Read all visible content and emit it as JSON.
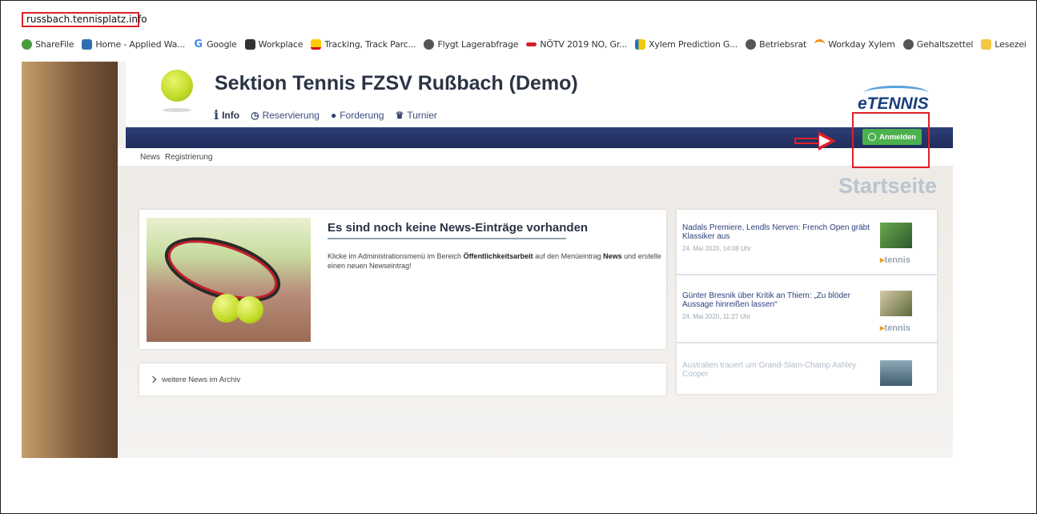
{
  "browser": {
    "url": "russbach.tennisplatz.info",
    "bookmarks": [
      {
        "label": "ShareFile",
        "icon": "sharefile-icon",
        "color": "#4a9d3c"
      },
      {
        "label": "Home - Applied Wa...",
        "icon": "home-icon",
        "color": "#2f6fb0"
      },
      {
        "label": "Google",
        "icon": "google-icon",
        "color": "#4285f4"
      },
      {
        "label": "Workplace",
        "icon": "workplace-icon",
        "color": "#333333"
      },
      {
        "label": "Tracking, Track Parc...",
        "icon": "dhl-icon",
        "color": "#ffcc00"
      },
      {
        "label": "Flygt Lagerabfrage",
        "icon": "globe-icon",
        "color": "#555555"
      },
      {
        "label": "NÖTV 2019 NO, Gr...",
        "icon": "notv-icon",
        "color": "#d0202a"
      },
      {
        "label": "Xylem Prediction G...",
        "icon": "powerbi-icon",
        "color": "#f2c811"
      },
      {
        "label": "Betriebsrat",
        "icon": "globe-icon",
        "color": "#555555"
      },
      {
        "label": "Workday Xylem",
        "icon": "workday-icon",
        "color": "#f38b00"
      },
      {
        "label": "Gehaltszettel",
        "icon": "globe-icon",
        "color": "#555555"
      },
      {
        "label": "Lesezei",
        "icon": "folder-icon",
        "color": "#f3c744"
      }
    ]
  },
  "site": {
    "title": "Sektion Tennis FZSV Rußbach (Demo)",
    "menu": {
      "info": "Info",
      "reservierung": "Reservierung",
      "forderung": "Forderung",
      "turnier": "Turnier"
    },
    "logo_text": "eTENNIS",
    "login_label": "Anmelden",
    "subnav": {
      "news": "News",
      "registrierung": "Registrierung"
    },
    "page_heading": "Startseite",
    "news": {
      "title": "Es sind noch keine News-Einträge vorhanden",
      "body_1": "Klicke im Administrationsmenü im Bereich ",
      "body_bold_1": "Öffentlichkeitsarbeit",
      "body_2": " auf den Menüeintrag ",
      "body_bold_2": "News",
      "body_3": " und erstelle einen neuen Newseintrag!"
    },
    "archive_label": "weitere News im Archiv",
    "side_news": [
      {
        "title": "Nadals Premiere, Lendls Nerven: French Open gräbt Klassiker aus",
        "date": "24. Mai 2020, 14:08 Uhr",
        "source": "tennis"
      },
      {
        "title": "Günter Bresnik über Kritik an Thiem: „Zu blöder Aussage hinreißen lassen“",
        "date": "24. Mai 2020, 11:27 Uhr",
        "source": "tennis"
      },
      {
        "title": "Australien trauert um Grand-Slam-Champ Ashley Cooper",
        "date": "",
        "source": ""
      }
    ]
  },
  "colors": {
    "annotation": "#e0202a",
    "login_button": "#4bb04e",
    "navbar": "#1f2c5c"
  }
}
